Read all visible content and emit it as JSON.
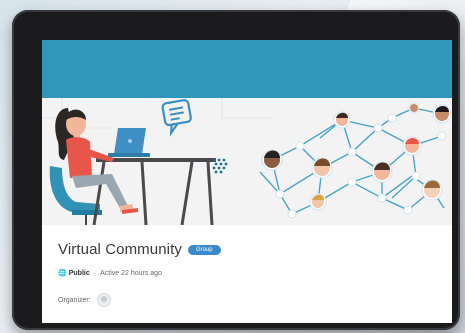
{
  "group": {
    "title": "Virtual Community",
    "badge": "Group",
    "privacy_icon": "globe-icon",
    "privacy": "Public",
    "separator": "·",
    "activity": "Active 22 hours ago",
    "organizer_label": "Organizer:"
  },
  "colors": {
    "header_bar": "#2f97b9",
    "badge": "#3b89c9",
    "hero_background": "#f3f3f4"
  },
  "hero": {
    "illustration": "woman-working-on-laptop-and-social-network",
    "icons": [
      "chat-bubble-icon",
      "laptop-icon",
      "dots-grid-icon",
      "network-icon"
    ]
  }
}
